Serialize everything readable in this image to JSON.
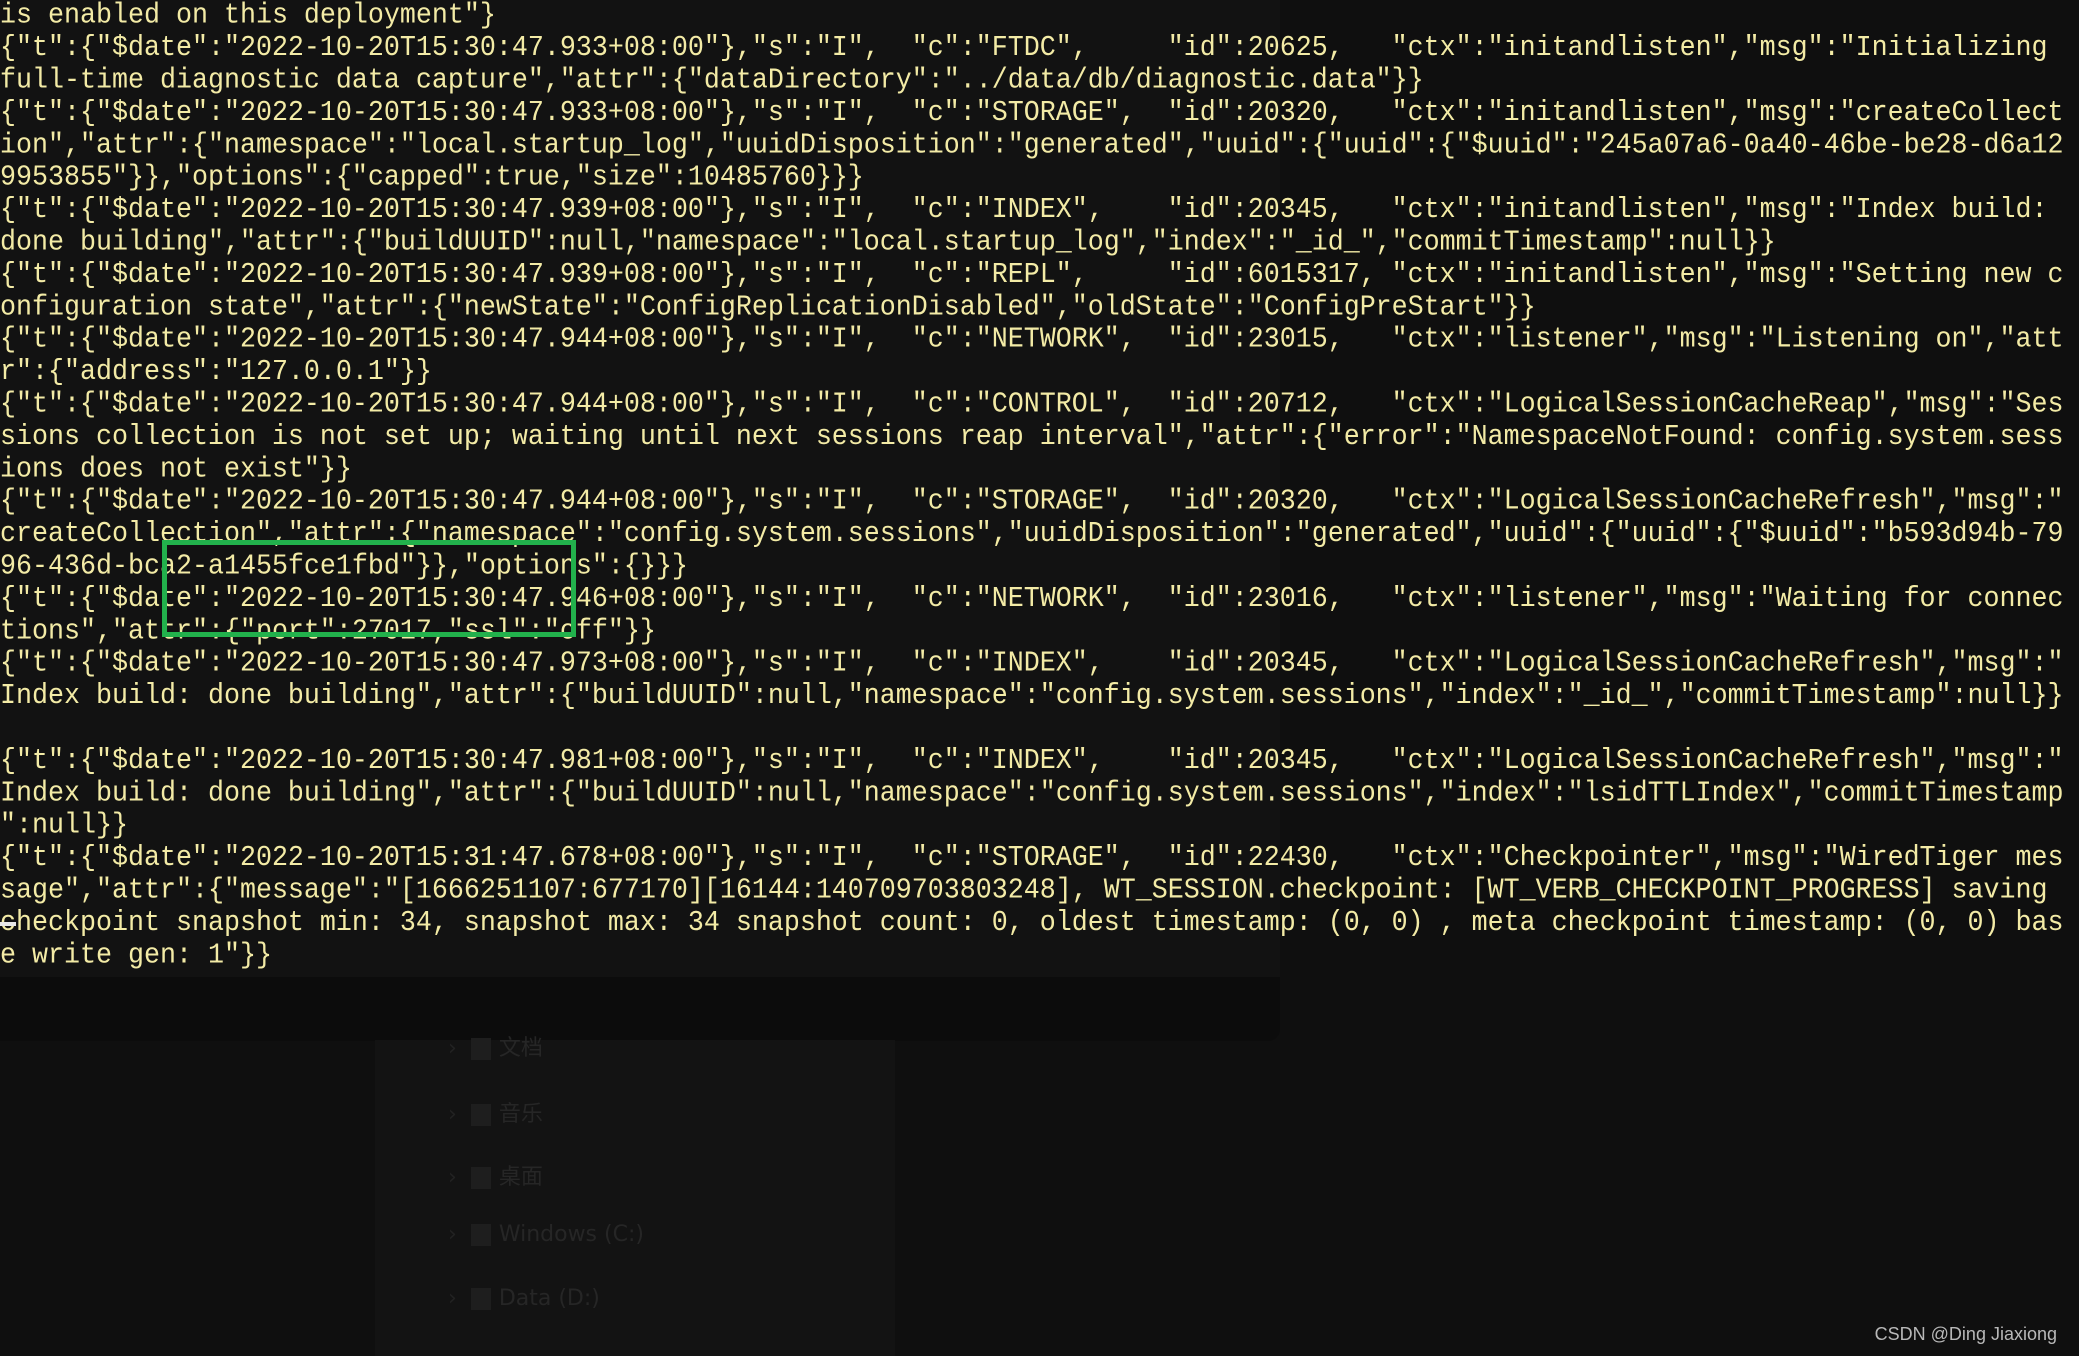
{
  "terminal": {
    "text_color": "#f3eba6",
    "background": "#0f0f0f",
    "lines": [
      "is enabled on this deployment\"}",
      "{\"t\":{\"$date\":\"2022-10-20T15:30:47.933+08:00\"},\"s\":\"I\",  \"c\":\"FTDC\",     \"id\":20625,   \"ctx\":\"initandlisten\",\"msg\":\"Initializing",
      "full-time diagnostic data capture\",\"attr\":{\"dataDirectory\":\"../data/db/diagnostic.data\"}}",
      "{\"t\":{\"$date\":\"2022-10-20T15:30:47.933+08:00\"},\"s\":\"I\",  \"c\":\"STORAGE\",  \"id\":20320,   \"ctx\":\"initandlisten\",\"msg\":\"createCollect",
      "ion\",\"attr\":{\"namespace\":\"local.startup_log\",\"uuidDisposition\":\"generated\",\"uuid\":{\"uuid\":{\"$uuid\":\"245a07a6-0a40-46be-be28-d6a12",
      "9953855\"}},\"options\":{\"capped\":true,\"size\":10485760}}}",
      "{\"t\":{\"$date\":\"2022-10-20T15:30:47.939+08:00\"},\"s\":\"I\",  \"c\":\"INDEX\",    \"id\":20345,   \"ctx\":\"initandlisten\",\"msg\":\"Index build:",
      "done building\",\"attr\":{\"buildUUID\":null,\"namespace\":\"local.startup_log\",\"index\":\"_id_\",\"commitTimestamp\":null}}",
      "{\"t\":{\"$date\":\"2022-10-20T15:30:47.939+08:00\"},\"s\":\"I\",  \"c\":\"REPL\",     \"id\":6015317, \"ctx\":\"initandlisten\",\"msg\":\"Setting new c",
      "onfiguration state\",\"attr\":{\"newState\":\"ConfigReplicationDisabled\",\"oldState\":\"ConfigPreStart\"}}",
      "{\"t\":{\"$date\":\"2022-10-20T15:30:47.944+08:00\"},\"s\":\"I\",  \"c\":\"NETWORK\",  \"id\":23015,   \"ctx\":\"listener\",\"msg\":\"Listening on\",\"att",
      "r\":{\"address\":\"127.0.0.1\"}}",
      "{\"t\":{\"$date\":\"2022-10-20T15:30:47.944+08:00\"},\"s\":\"I\",  \"c\":\"CONTROL\",  \"id\":20712,   \"ctx\":\"LogicalSessionCacheReap\",\"msg\":\"Ses",
      "sions collection is not set up; waiting until next sessions reap interval\",\"attr\":{\"error\":\"NamespaceNotFound: config.system.sess",
      "ions does not exist\"}}",
      "{\"t\":{\"$date\":\"2022-10-20T15:30:47.944+08:00\"},\"s\":\"I\",  \"c\":\"STORAGE\",  \"id\":20320,   \"ctx\":\"LogicalSessionCacheRefresh\",\"msg\":\"",
      "createCollection\",\"attr\":{\"namespace\":\"config.system.sessions\",\"uuidDisposition\":\"generated\",\"uuid\":{\"uuid\":{\"$uuid\":\"b593d94b-79",
      "96-436d-bca2-a1455fce1fbd\"}},\"options\":{}}}",
      "{\"t\":{\"$date\":\"2022-10-20T15:30:47.946+08:00\"},\"s\":\"I\",  \"c\":\"NETWORK\",  \"id\":23016,   \"ctx\":\"listener\",\"msg\":\"Waiting for connec",
      "tions\",\"attr\":{\"port\":27017,\"ssl\":\"off\"}}",
      "{\"t\":{\"$date\":\"2022-10-20T15:30:47.973+08:00\"},\"s\":\"I\",  \"c\":\"INDEX\",    \"id\":20345,   \"ctx\":\"LogicalSessionCacheRefresh\",\"msg\":\"",
      "Index build: done building\",\"attr\":{\"buildUUID\":null,\"namespace\":\"config.system.sessions\",\"index\":\"_id_\",\"commitTimestamp\":null}}",
      "",
      "{\"t\":{\"$date\":\"2022-10-20T15:30:47.981+08:00\"},\"s\":\"I\",  \"c\":\"INDEX\",    \"id\":20345,   \"ctx\":\"LogicalSessionCacheRefresh\",\"msg\":\"",
      "Index build: done building\",\"attr\":{\"buildUUID\":null,\"namespace\":\"config.system.sessions\",\"index\":\"lsidTTLIndex\",\"commitTimestamp",
      "\":null}}",
      "{\"t\":{\"$date\":\"2022-10-20T15:31:47.678+08:00\"},\"s\":\"I\",  \"c\":\"STORAGE\",  \"id\":22430,   \"ctx\":\"Checkpointer\",\"msg\":\"WiredTiger mes",
      "sage\",\"attr\":{\"message\":\"[1666251107:677170][16144:140709703803248], WT_SESSION.checkpoint: [WT_VERB_CHECKPOINT_PROGRESS] saving",
      "checkpoint snapshot min: 34, snapshot max: 34 snapshot count: 0, oldest timestamp: (0, 0) , meta checkpoint timestamp: (0, 0) bas",
      "e write gen: 1\"}}"
    ]
  },
  "annotation": {
    "highlight_color": "#22b14c"
  },
  "background_explorer": {
    "items": [
      "文档",
      "音乐",
      "桌面",
      "Windows (C:)",
      "Data (D:)"
    ]
  },
  "watermark": "CSDN @Ding Jiaxiong"
}
